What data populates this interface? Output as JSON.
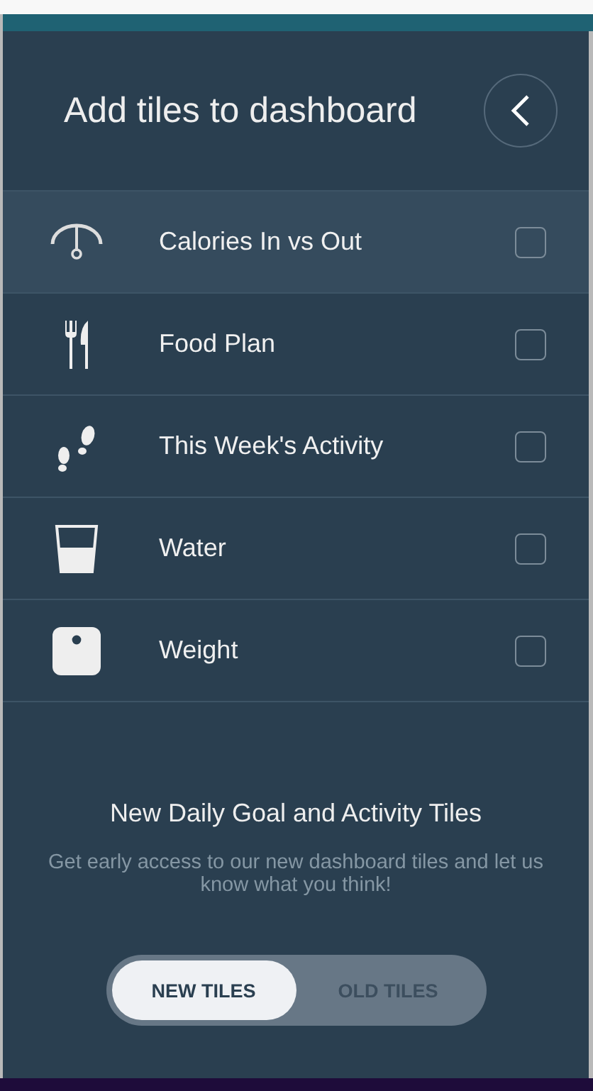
{
  "header": {
    "title": "Add tiles to dashboard"
  },
  "tiles": [
    {
      "label": "Calories In vs Out",
      "kind": "gauge",
      "checked": false,
      "selected": true
    },
    {
      "label": "Food Plan",
      "kind": "utensils",
      "checked": false,
      "selected": false
    },
    {
      "label": "This Week's Activity",
      "kind": "footprints",
      "checked": false,
      "selected": false
    },
    {
      "label": "Water",
      "kind": "glass",
      "checked": false,
      "selected": false
    },
    {
      "label": "Weight",
      "kind": "scale",
      "checked": false,
      "selected": false
    }
  ],
  "promo": {
    "title": "New Daily Goal and Activity Tiles",
    "text": "Get early access to our new dashboard tiles and let us know what you think!"
  },
  "toggle": [
    {
      "label": "NEW TILES",
      "selected": true
    },
    {
      "label": "OLD TILES",
      "selected": false
    }
  ]
}
